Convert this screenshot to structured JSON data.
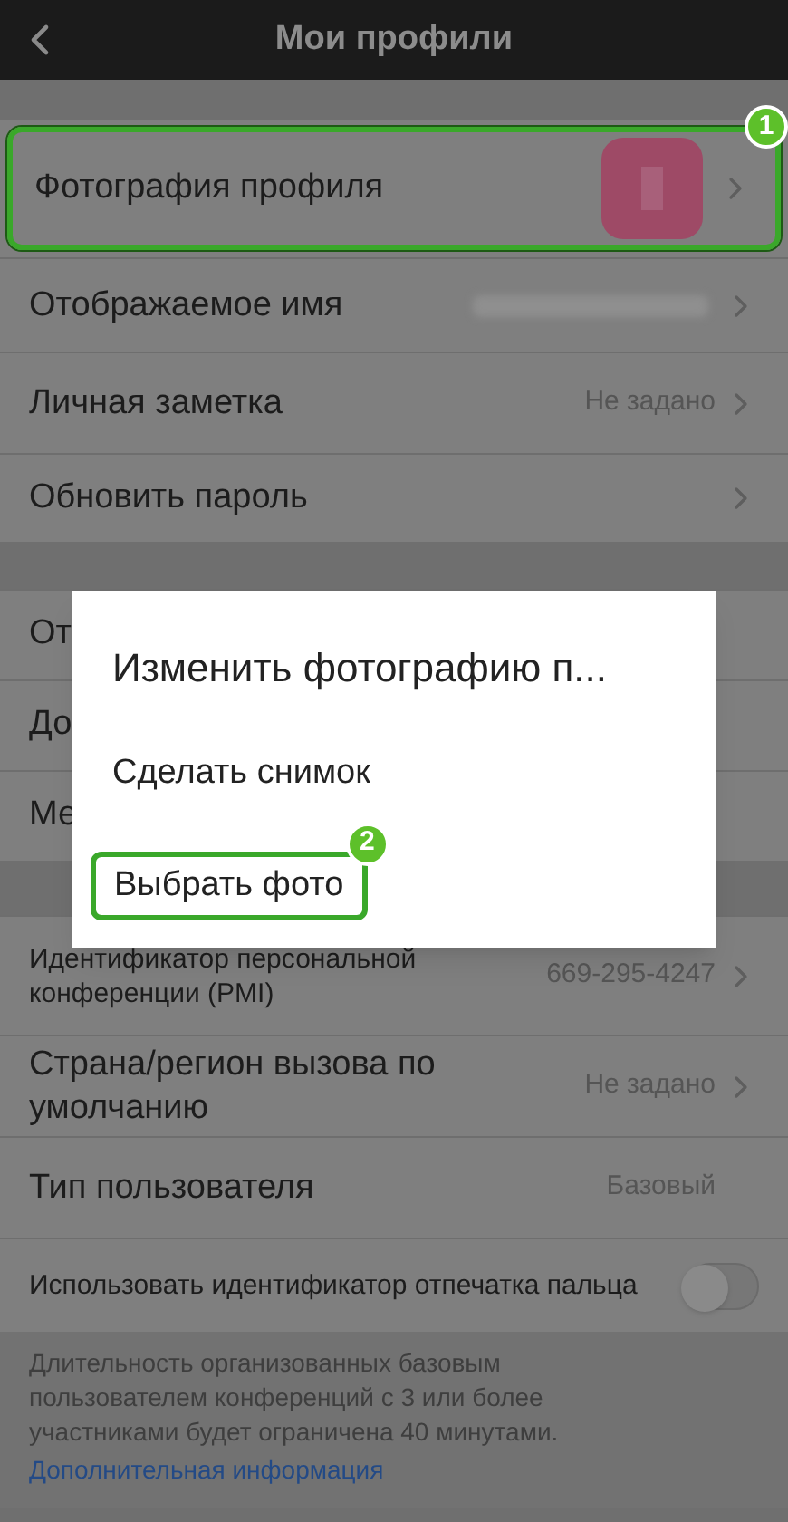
{
  "header": {
    "title": "Мои профили"
  },
  "section_1": [
    {
      "label": "Фотография профиля",
      "callout": "1",
      "chevron": true
    },
    {
      "kind": "blurred",
      "label": "Отображаемое имя",
      "chevron": true
    },
    {
      "kind": "value",
      "label": "Личная заметка",
      "value": "Не задано",
      "chevron": true
    },
    {
      "kind": "plain",
      "label": "Обновить пароль",
      "chevron": true
    }
  ],
  "section_2": [
    {
      "label": "От"
    },
    {
      "label": "До"
    },
    {
      "label": "Ме"
    }
  ],
  "section_3": [
    {
      "kind": "value",
      "label": "Идентификатор персональной конференции (PMI)",
      "value": "669-295-4247",
      "chevron": true,
      "small": true
    },
    {
      "kind": "value",
      "label": "Страна/регион вызова по умолчанию",
      "value": "Не задано",
      "chevron": true,
      "small": false
    },
    {
      "kind": "value",
      "label": "Тип пользователя",
      "value": "Базовый",
      "chevron": false,
      "small": false
    },
    {
      "kind": "toggle",
      "label": "Использовать идентификатор отпечатка пальца",
      "on": false,
      "small": true
    }
  ],
  "footer": {
    "note": "Длительность организованных базовым пользователем конференций с 3 или более участниками будет ограничена 40 минутами.",
    "link": "Дополнительная информация"
  },
  "dialog": {
    "title": "Изменить фотографию п...",
    "options": [
      {
        "label": "Сделать снимок"
      },
      {
        "label": "Выбрать фото",
        "callout": "2"
      }
    ]
  }
}
